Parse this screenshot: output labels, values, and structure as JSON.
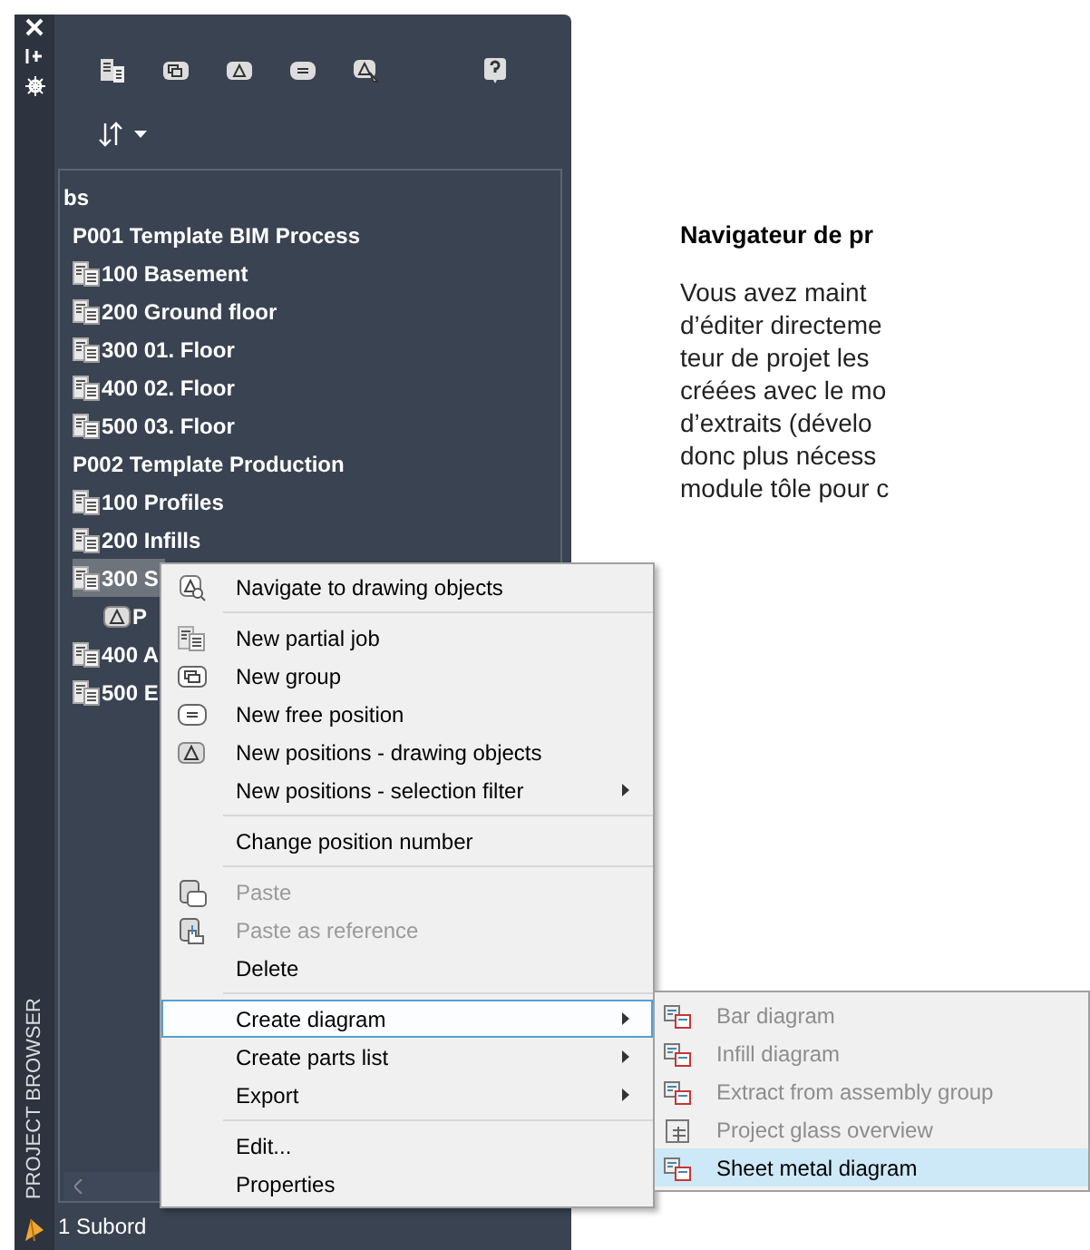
{
  "sidebar": {
    "title": "PROJECT BROWSER"
  },
  "tree": {
    "root": "bs",
    "items": [
      {
        "label": "P001 Template BIM Process",
        "kind": "project",
        "selected": false,
        "children": [
          {
            "label": "100 Basement",
            "kind": "job",
            "selected": false
          },
          {
            "label": "200 Ground floor",
            "kind": "job",
            "selected": false
          },
          {
            "label": "300 01. Floor",
            "kind": "job",
            "selected": false
          },
          {
            "label": "400 02. Floor",
            "kind": "job",
            "selected": false
          },
          {
            "label": "500 03. Floor",
            "kind": "job",
            "selected": false
          }
        ]
      },
      {
        "label": "P002 Template Production",
        "kind": "project",
        "selected": false,
        "children": [
          {
            "label": "100 Profiles",
            "kind": "job",
            "selected": false
          },
          {
            "label": "200 Infills",
            "kind": "job",
            "selected": false
          },
          {
            "label": "300 S",
            "kind": "job",
            "selected": true,
            "children": [
              {
                "label": "P",
                "kind": "position",
                "selected": false
              }
            ]
          },
          {
            "label": "400 A",
            "kind": "job",
            "selected": false
          },
          {
            "label": "500 E",
            "kind": "job",
            "selected": false
          }
        ]
      }
    ]
  },
  "status_bar": "1 Subord",
  "article": {
    "heading": "Navigateur de pr",
    "lines": [
      "Vous avez maint",
      "d’éditer directeme",
      "teur de projet les",
      "créées avec le mo",
      "d’extraits (dévelo",
      "donc plus nécess",
      "module tôle pour c"
    ]
  },
  "context_menu": [
    [
      {
        "label": "Navigate to drawing objects",
        "disabled": false,
        "submenu": false,
        "selected": false
      }
    ],
    [
      {
        "label": "New partial job",
        "disabled": false,
        "submenu": false,
        "selected": false
      },
      {
        "label": "New group",
        "disabled": false,
        "submenu": false,
        "selected": false
      },
      {
        "label": "New free position",
        "disabled": false,
        "submenu": false,
        "selected": false
      },
      {
        "label": "New positions - drawing objects",
        "disabled": false,
        "submenu": false,
        "selected": false
      },
      {
        "label": "New positions - selection filter",
        "disabled": false,
        "submenu": true,
        "selected": false
      }
    ],
    [
      {
        "label": "Change position number",
        "disabled": false,
        "submenu": false,
        "selected": false
      }
    ],
    [
      {
        "label": "Paste",
        "disabled": true,
        "submenu": false,
        "selected": false
      },
      {
        "label": "Paste as reference",
        "disabled": true,
        "submenu": false,
        "selected": false
      },
      {
        "label": "Delete",
        "disabled": false,
        "submenu": false,
        "selected": false
      }
    ],
    [
      {
        "label": "Create diagram",
        "disabled": false,
        "submenu": true,
        "selected": true
      },
      {
        "label": "Create parts list",
        "disabled": false,
        "submenu": true,
        "selected": false
      },
      {
        "label": "Export",
        "disabled": false,
        "submenu": true,
        "selected": false
      }
    ],
    [
      {
        "label": "Edit...",
        "disabled": false,
        "submenu": false,
        "selected": false
      },
      {
        "label": "Properties",
        "disabled": false,
        "submenu": false,
        "selected": false
      }
    ]
  ],
  "submenu": [
    {
      "label": "Bar diagram",
      "disabled": true,
      "selected": false
    },
    {
      "label": "Infill diagram",
      "disabled": true,
      "selected": false
    },
    {
      "label": "Extract from assembly group",
      "disabled": true,
      "selected": false
    },
    {
      "label": "Project glass overview",
      "disabled": true,
      "selected": false
    },
    {
      "label": "Sheet metal diagram",
      "disabled": false,
      "selected": true
    }
  ]
}
